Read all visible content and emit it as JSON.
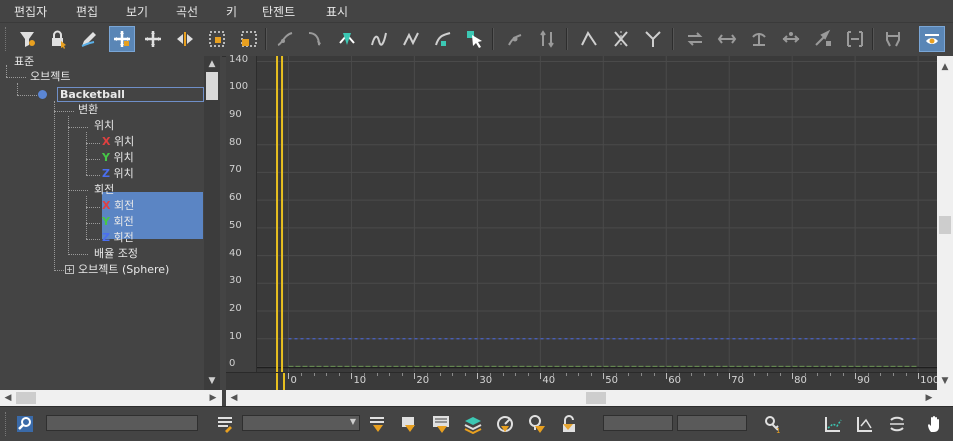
{
  "menu": {
    "items": [
      "편집자",
      "편집",
      "보기",
      "곡선",
      "키",
      "탄젠트",
      "표시"
    ]
  },
  "toolbar": {
    "icons": [
      "filter-icon",
      "lock-selection-icon",
      "pencil-icon",
      "move-keys-icon",
      "move-keys-dropdown-icon",
      "slide-keys-icon",
      "scale-keys-icon",
      "scale-values-icon",
      "add-keys-icon",
      "draw-curves-icon",
      "reduce-keys-icon",
      "auto-tangent-icon",
      "spline-tangent-icon",
      "fast-tangent-icon",
      "slow-tangent-icon",
      "cursor-tangent-icon",
      "lock-tangents-icon",
      "parameter-curve-icon",
      "ease-curve-icon",
      "multiplier-curve-icon",
      "key-stats-icon",
      "show-tangents-icon",
      "isolate-curve-icon",
      "frame-horizontal-icon",
      "frame-values-icon",
      "zoom-region-icon",
      "zoom-values-icon",
      "pan-icon",
      "fit-icon",
      "view-dropdown-icon",
      "show-keyable-icon"
    ]
  },
  "tree": {
    "root": "표준",
    "objects": "오브젝트",
    "item": "Backetball",
    "transform": "변환",
    "position": "위치",
    "x_pos": "위치",
    "y_pos": "위치",
    "z_pos": "위치",
    "rotation": "회전",
    "x_rot": "회전",
    "y_rot": "회전",
    "z_rot": "회전",
    "scale": "배율 조정",
    "sphere": "오브젝트 (Sphere)",
    "axis_x": "X",
    "axis_y": "Y",
    "axis_z": "Z"
  },
  "graph": {
    "y_ticks": [
      "140",
      "100",
      "90",
      "80",
      "70",
      "60",
      "50",
      "40",
      "30",
      "20",
      "10",
      "0"
    ],
    "x_ticks": [
      "0",
      "10",
      "20",
      "30",
      "40",
      "50",
      "60",
      "70",
      "80",
      "90",
      "100"
    ],
    "colors": {
      "time_slider": "#e8c020",
      "curve_dash": "#4a62c8",
      "curve_flat": "#7aa860",
      "grid": "#4a4a4a"
    }
  },
  "statusbar": {
    "icons": [
      "zoom-selected-icon",
      "filter-name-icon",
      "show-selected-key-icon",
      "show-all-tangents-icon",
      "show-curves-icon",
      "lock-keys-icon",
      "isolate-icon",
      "keyframe-icon",
      "track-select-icon",
      "pan-hand-icon"
    ]
  },
  "chart_data": {
    "type": "line",
    "x": [
      0,
      10,
      20,
      30,
      40,
      50,
      60,
      70,
      80,
      90,
      100
    ],
    "series": [
      {
        "values": [
          10,
          10,
          10,
          10,
          10,
          10,
          10,
          10,
          10,
          10,
          10
        ]
      },
      {
        "values": [
          0,
          0,
          0,
          0,
          0,
          0,
          0,
          0,
          0,
          0,
          0
        ]
      }
    ],
    "xlim": [
      -5,
      103
    ],
    "ylim": [
      -2,
      112
    ],
    "grid": true
  }
}
